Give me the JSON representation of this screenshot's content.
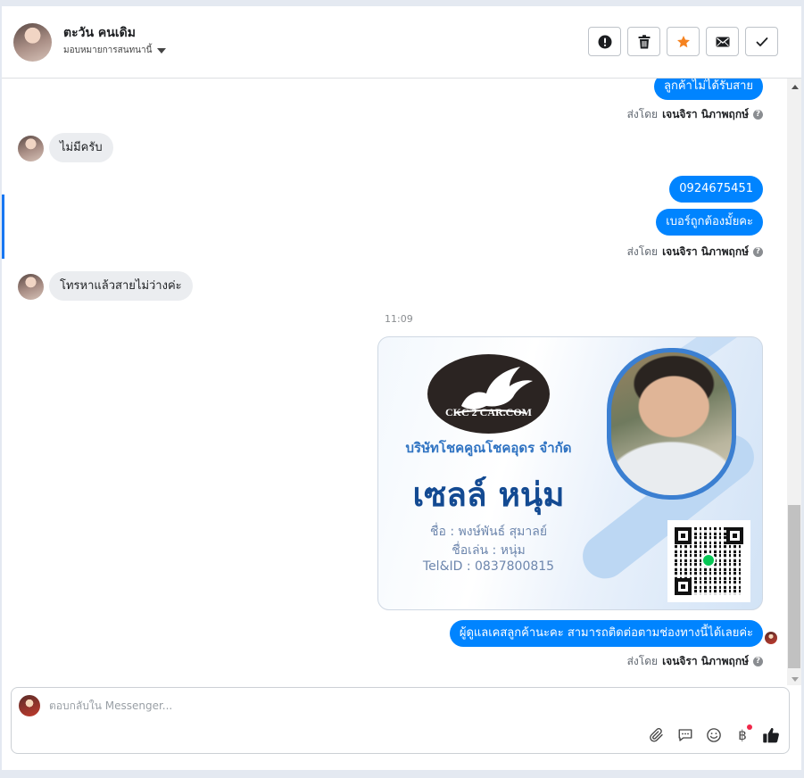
{
  "header": {
    "contact_name": "ตะวัน คนเดิม",
    "assign_label": "มอบหมายการสนทนานี้",
    "actions": [
      {
        "name": "report",
        "icon": "exclamation-circle-icon"
      },
      {
        "name": "delete",
        "icon": "trash-icon"
      },
      {
        "name": "star",
        "icon": "star-icon",
        "color": "#f5821f"
      },
      {
        "name": "email",
        "icon": "envelope-icon"
      },
      {
        "name": "done",
        "icon": "check-icon"
      }
    ]
  },
  "messages": {
    "m1_out": "ลูกค้าไม่ได้รับสาย",
    "m2_in": "ไม่มีครับ",
    "m3_out": "0924675451",
    "m4_out": "เบอร์ถูกต้องมั้ยคะ",
    "m5_in": "โทรหาแล้วสายไม่ว่างค่ะ",
    "timestamp": "11:09",
    "m6_out": "ผู้ดูแลเคสลูกค้านะคะ สามารถติดต่อตามช่องทางนี้ได้เลยค่ะ"
  },
  "sent_by": {
    "prefix": "ส่งโดย",
    "agent": "เจนจิรา นิภาพฤกษ์",
    "help_icon": "question-circle-icon"
  },
  "card": {
    "logo_text": "CKC 2 CAR.COM",
    "company": "บริษัทโชคคูณโชคอุดร จำกัด",
    "sale_name": "เซลล์ หนุ่ม",
    "name_line": "ชื่อ : พงษ์พันธ์ สุมาลย์",
    "nickname_line": "ชื่อเล่น : หนุ่ม",
    "tel_line": "Tel&ID : 0837800815"
  },
  "composer": {
    "placeholder": "ตอบกลับใน Messenger...",
    "tools": [
      "paperclip-icon",
      "quick-reply-icon",
      "emoji-icon",
      "baht-icon",
      "thumbs-up-icon"
    ],
    "baht_symbol": "฿"
  },
  "colors": {
    "accent": "#1877f2",
    "bubble_out": "#0084ff",
    "bubble_in": "#ebedf0",
    "star": "#f5821f"
  }
}
